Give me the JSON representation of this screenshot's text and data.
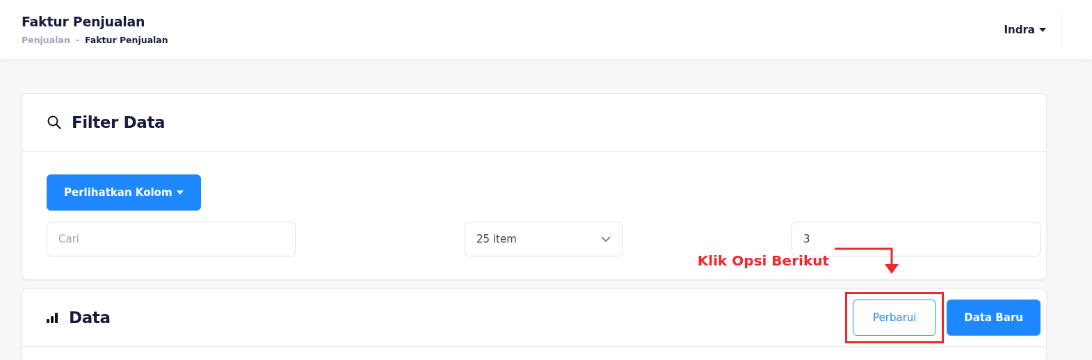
{
  "header": {
    "title": "Faktur Penjualan",
    "breadcrumb": [
      {
        "label": "Penjualan",
        "current": false
      },
      {
        "label": "Faktur Penjualan",
        "current": true
      }
    ],
    "separator": "-",
    "user": "Indra"
  },
  "filter_card": {
    "title": "Filter Data",
    "columns_button": "Perlihatkan Kolom",
    "search": {
      "placeholder": "Cari"
    },
    "per_page": {
      "value": "25 item"
    },
    "field_3": {
      "value": "3"
    }
  },
  "data_card": {
    "title": "Data",
    "buttons": [
      {
        "label": "Perbarui",
        "kind": "outline",
        "highlighted": true
      },
      {
        "label": "Data Baru",
        "kind": "primary",
        "highlighted": false
      }
    ]
  },
  "annotation": {
    "text": "Klik Opsi Berikut"
  }
}
